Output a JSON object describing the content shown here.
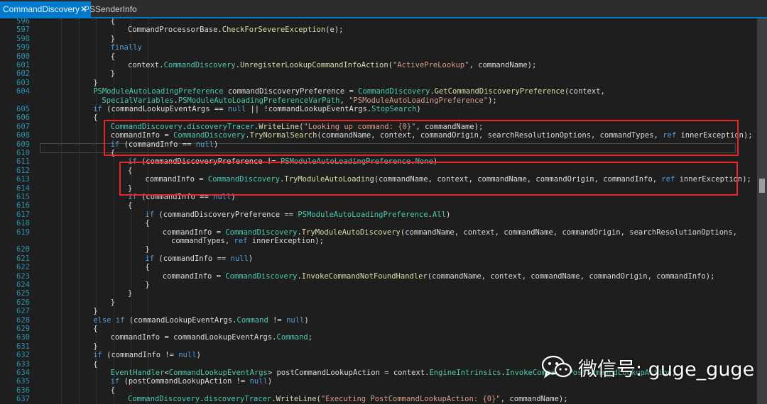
{
  "tabs": [
    {
      "label": "CommandDiscovery",
      "active": true
    },
    {
      "label": "PSSenderInfo",
      "active": false
    }
  ],
  "editor": {
    "lines": [
      {
        "n": "596",
        "ind": 4,
        "t": [
          [
            "{",
            ""
          ]
        ]
      },
      {
        "n": "597",
        "ind": 5,
        "t": [
          [
            "CommandProcessorBase.",
            ""
          ],
          [
            "CheckForSevereException",
            "mt"
          ],
          [
            "(e);",
            ""
          ]
        ]
      },
      {
        "n": "598",
        "ind": 4,
        "t": [
          [
            "}",
            ""
          ]
        ]
      },
      {
        "n": "599",
        "ind": 4,
        "t": [
          [
            "finally",
            "kw"
          ]
        ]
      },
      {
        "n": "600",
        "ind": 4,
        "t": [
          [
            "{",
            ""
          ]
        ]
      },
      {
        "n": "601",
        "ind": 5,
        "t": [
          [
            "context.",
            ""
          ],
          [
            "CommandDiscovery",
            "ty"
          ],
          [
            ".",
            ""
          ],
          [
            "UnregisterLookupCommandInfoAction",
            "mt"
          ],
          [
            "(",
            ""
          ],
          [
            "\"ActivePreLookup\"",
            "st"
          ],
          [
            ", commandName);",
            ""
          ]
        ]
      },
      {
        "n": "602",
        "ind": 4,
        "t": [
          [
            "}",
            ""
          ]
        ]
      },
      {
        "n": "603",
        "ind": 3,
        "t": [
          [
            "}",
            ""
          ]
        ]
      },
      {
        "n": "604",
        "ind": 3,
        "t": [
          [
            "PSModuleAutoLoadingPreference",
            "ty"
          ],
          [
            " commandDiscoveryPreference = ",
            ""
          ],
          [
            "CommandDiscovery",
            "ty"
          ],
          [
            ".",
            ""
          ],
          [
            "GetCommandDiscoveryPreference",
            "mt"
          ],
          [
            "(context,",
            ""
          ]
        ]
      },
      {
        "n": "",
        "ind": 3.5,
        "t": [
          [
            "SpecialVariables",
            "ty"
          ],
          [
            ".",
            ""
          ],
          [
            "PSModuleAutoLoadingPreferenceVarPath",
            "ty"
          ],
          [
            ", ",
            ""
          ],
          [
            "\"PSModuleAutoLoadingPreference\"",
            "st"
          ],
          [
            ");",
            ""
          ]
        ]
      },
      {
        "n": "605",
        "ind": 3,
        "t": [
          [
            "if",
            "kw"
          ],
          [
            " (commandLookupEventArgs == ",
            ""
          ],
          [
            "null",
            "kw"
          ],
          [
            " || !commandLookupEventArgs.",
            ""
          ],
          [
            "StopSearch",
            "ty"
          ],
          [
            ")",
            ""
          ]
        ]
      },
      {
        "n": "606",
        "ind": 3,
        "t": [
          [
            "{",
            ""
          ]
        ]
      },
      {
        "n": "607",
        "ind": 4,
        "t": [
          [
            "CommandDiscovery",
            "ty"
          ],
          [
            ".",
            ""
          ],
          [
            "discoveryTracer",
            "ty"
          ],
          [
            ".",
            ""
          ],
          [
            "WriteLine",
            "mt"
          ],
          [
            "(",
            ""
          ],
          [
            "\"Looking up command: {0}\"",
            "st"
          ],
          [
            ", commandName);",
            ""
          ]
        ]
      },
      {
        "n": "608",
        "ind": 4,
        "t": [
          [
            "commandInfo = ",
            ""
          ],
          [
            "CommandDiscovery",
            "ty"
          ],
          [
            ".",
            ""
          ],
          [
            "TryNormalSearch",
            "mt"
          ],
          [
            "(commandName, context, commandOrigin, searchResolutionOptions, commandTypes, ",
            ""
          ],
          [
            "ref",
            "kw"
          ],
          [
            " innerException);",
            ""
          ]
        ]
      },
      {
        "n": "609",
        "ind": 4,
        "t": [
          [
            "if",
            "kw"
          ],
          [
            " (commandInfo == ",
            ""
          ],
          [
            "null",
            "kw"
          ],
          [
            ")",
            ""
          ]
        ]
      },
      {
        "n": "610",
        "ind": 4,
        "t": [
          [
            "{",
            ""
          ]
        ]
      },
      {
        "n": "611",
        "ind": 5,
        "t": [
          [
            "if",
            "kw"
          ],
          [
            " (commandDiscoveryPreference != ",
            ""
          ],
          [
            "PSModuleAutoLoadingPreference",
            "ty"
          ],
          [
            ".",
            ""
          ],
          [
            "None",
            "ty"
          ],
          [
            ")",
            ""
          ]
        ]
      },
      {
        "n": "612",
        "ind": 5,
        "t": [
          [
            "{",
            ""
          ]
        ]
      },
      {
        "n": "613",
        "ind": 6,
        "t": [
          [
            "commandInfo = ",
            ""
          ],
          [
            "CommandDiscovery",
            "ty"
          ],
          [
            ".",
            ""
          ],
          [
            "TryModuleAutoLoading",
            "mt"
          ],
          [
            "(commandName, context, commandName, commandOrigin, commandInfo, ",
            ""
          ],
          [
            "ref",
            "kw"
          ],
          [
            " innerException);",
            ""
          ]
        ]
      },
      {
        "n": "614",
        "ind": 5,
        "t": [
          [
            "}",
            ""
          ]
        ]
      },
      {
        "n": "615",
        "ind": 5,
        "t": [
          [
            "if",
            "kw"
          ],
          [
            " (commandInfo == ",
            ""
          ],
          [
            "null",
            "kw"
          ],
          [
            ")",
            ""
          ]
        ]
      },
      {
        "n": "616",
        "ind": 5,
        "t": [
          [
            "{",
            ""
          ]
        ]
      },
      {
        "n": "617",
        "ind": 6,
        "t": [
          [
            "if",
            "kw"
          ],
          [
            " (commandDiscoveryPreference == ",
            ""
          ],
          [
            "PSModuleAutoLoadingPreference",
            "ty"
          ],
          [
            ".",
            ""
          ],
          [
            "All",
            "ty"
          ],
          [
            ")",
            ""
          ]
        ]
      },
      {
        "n": "618",
        "ind": 6,
        "t": [
          [
            "{",
            ""
          ]
        ]
      },
      {
        "n": "619",
        "ind": 7,
        "t": [
          [
            "commandInfo = ",
            ""
          ],
          [
            "CommandDiscovery",
            "ty"
          ],
          [
            ".",
            ""
          ],
          [
            "TryModuleAutoDiscovery",
            "mt"
          ],
          [
            "(commandName, context, commandName, commandOrigin, searchResolutionOptions,",
            ""
          ]
        ]
      },
      {
        "n": "",
        "ind": 7.5,
        "t": [
          [
            "commandTypes, ",
            ""
          ],
          [
            "ref",
            "kw"
          ],
          [
            " innerException);",
            ""
          ]
        ]
      },
      {
        "n": "620",
        "ind": 6,
        "t": [
          [
            "}",
            ""
          ]
        ]
      },
      {
        "n": "621",
        "ind": 6,
        "t": [
          [
            "if",
            "kw"
          ],
          [
            " (commandInfo == ",
            ""
          ],
          [
            "null",
            "kw"
          ],
          [
            ")",
            ""
          ]
        ]
      },
      {
        "n": "622",
        "ind": 6,
        "t": [
          [
            "{",
            ""
          ]
        ]
      },
      {
        "n": "623",
        "ind": 7,
        "t": [
          [
            "commandInfo = ",
            ""
          ],
          [
            "CommandDiscovery",
            "ty"
          ],
          [
            ".",
            ""
          ],
          [
            "InvokeCommandNotFoundHandler",
            "mt"
          ],
          [
            "(commandName, context, commandName, commandOrigin, commandInfo);",
            ""
          ]
        ]
      },
      {
        "n": "624",
        "ind": 6,
        "t": [
          [
            "}",
            ""
          ]
        ]
      },
      {
        "n": "625",
        "ind": 5,
        "t": [
          [
            "}",
            ""
          ]
        ]
      },
      {
        "n": "626",
        "ind": 4,
        "t": [
          [
            "}",
            ""
          ]
        ]
      },
      {
        "n": "627",
        "ind": 3,
        "t": [
          [
            "}",
            ""
          ]
        ]
      },
      {
        "n": "628",
        "ind": 3,
        "t": [
          [
            "else",
            "kw"
          ],
          [
            " ",
            ""
          ],
          [
            "if",
            "kw"
          ],
          [
            " (commandLookupEventArgs.",
            ""
          ],
          [
            "Command",
            "ty"
          ],
          [
            " != ",
            ""
          ],
          [
            "null",
            "kw"
          ],
          [
            ")",
            ""
          ]
        ]
      },
      {
        "n": "629",
        "ind": 3,
        "t": [
          [
            "{",
            ""
          ]
        ]
      },
      {
        "n": "630",
        "ind": 4,
        "t": [
          [
            "commandInfo = commandLookupEventArgs.",
            ""
          ],
          [
            "Command",
            "ty"
          ],
          [
            ";",
            ""
          ]
        ]
      },
      {
        "n": "631",
        "ind": 3,
        "t": [
          [
            "}",
            ""
          ]
        ]
      },
      {
        "n": "632",
        "ind": 3,
        "t": [
          [
            "if",
            "kw"
          ],
          [
            " (commandInfo != ",
            ""
          ],
          [
            "null",
            "kw"
          ],
          [
            ")",
            ""
          ]
        ]
      },
      {
        "n": "633",
        "ind": 3,
        "t": [
          [
            "{",
            ""
          ]
        ]
      },
      {
        "n": "634",
        "ind": 4,
        "t": [
          [
            "EventHandler",
            "ty"
          ],
          [
            "<",
            ""
          ],
          [
            "CommandLookupEventArgs",
            "ty"
          ],
          [
            "> postCommandLookupAction = context.",
            ""
          ],
          [
            "EngineIntrinsics",
            "ty"
          ],
          [
            ".",
            ""
          ],
          [
            "InvokeCommand",
            "ty"
          ],
          [
            ".",
            ""
          ],
          [
            "PostCommandLookupAction",
            "ty"
          ],
          [
            ";",
            ""
          ]
        ]
      },
      {
        "n": "635",
        "ind": 4,
        "t": [
          [
            "if",
            "kw"
          ],
          [
            " (postCommandLookupAction != ",
            ""
          ],
          [
            "null",
            "kw"
          ],
          [
            ")",
            ""
          ]
        ]
      },
      {
        "n": "636",
        "ind": 4,
        "t": [
          [
            "{",
            ""
          ]
        ]
      },
      {
        "n": "637",
        "ind": 5,
        "t": [
          [
            "CommandDiscovery",
            "ty"
          ],
          [
            ".",
            ""
          ],
          [
            "discoveryTracer",
            "ty"
          ],
          [
            ".",
            ""
          ],
          [
            "WriteLine",
            "mt"
          ],
          [
            "(",
            ""
          ],
          [
            "\"Executing PostCommandLookupAction: {0}\"",
            "st"
          ],
          [
            ", commandName);",
            ""
          ]
        ]
      }
    ]
  },
  "watermark": {
    "text": "微信号: guge_guge",
    "icon": "wechat-icon"
  },
  "colors": {
    "accent": "#007acc",
    "highlight": "#e8252b",
    "keyword": "#569cd6",
    "type": "#4ec9b0",
    "string": "#d69d85",
    "method": "#dcdcaa",
    "linenumber": "#2b91af"
  }
}
